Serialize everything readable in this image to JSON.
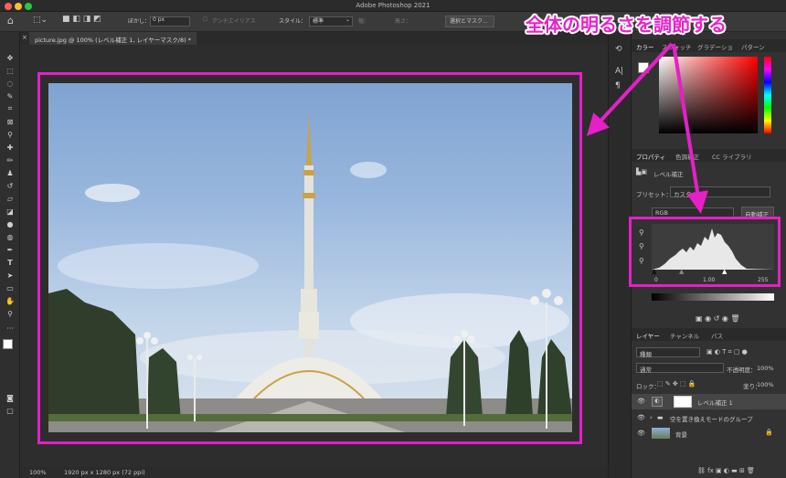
{
  "window": {
    "title": "Adobe Photoshop 2021"
  },
  "options": {
    "feather_label": "ぼかし：",
    "feather_value": "0 px",
    "antialias": "アンチエイリアス",
    "style_label": "スタイル：",
    "style_value": "標準",
    "width_label": "幅：",
    "height_label": "高さ：",
    "select_mask": "選択とマスク..."
  },
  "document": {
    "tab_title": "picture.jpg @ 100% (レベル補正 1, レイヤーマスク/8) *"
  },
  "status": {
    "zoom": "100%",
    "size": "1920 px x 1280 px (72 ppi)"
  },
  "color_panel": {
    "tabs": [
      "カラー",
      "スウォッチ",
      "グラデーショ",
      "パターン"
    ]
  },
  "properties": {
    "tabs": [
      "プロパティ",
      "色調補正",
      "CC ライブラリ"
    ],
    "adjustment": "レベル補正",
    "preset_label": "プリセット：",
    "preset_value": "カスタム",
    "channel": "RGB",
    "auto": "自動補正",
    "input_min": "0",
    "input_mid": "1.00",
    "input_max": "255"
  },
  "layers_panel": {
    "tabs": [
      "レイヤー",
      "チャンネル",
      "パス"
    ],
    "filter": "種類",
    "blend": "通常",
    "opacity_label": "不透明度：",
    "opacity": "100%",
    "lock_label": "ロック：",
    "fill_label": "塗り：",
    "fill": "100%",
    "layers": [
      {
        "name": "レベル補正 1"
      },
      {
        "name": "空を置き換えモードのグループ"
      },
      {
        "name": "背景"
      }
    ]
  },
  "annotation": {
    "text": "全体の明るさを調節する",
    "color": "#e61fc8"
  }
}
